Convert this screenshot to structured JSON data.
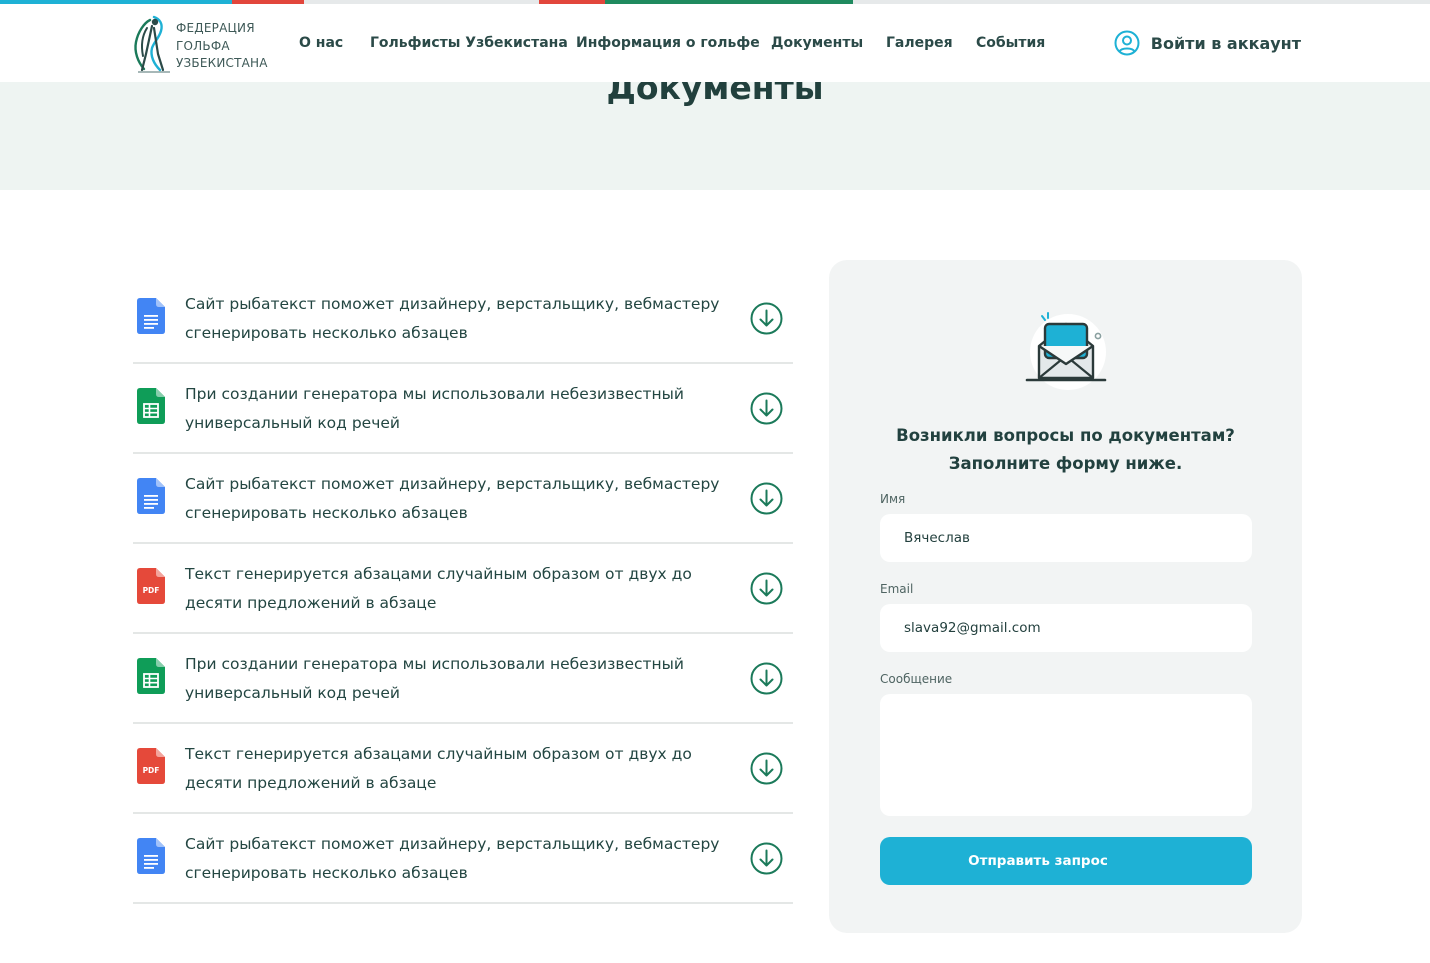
{
  "colors": {
    "accent": "#1eb1d5",
    "brand_green": "#1b7a5a",
    "text_dark": "#21403d",
    "hero_bg": "#eef4f2",
    "card_bg": "#f2f4f4",
    "topbar_red": "#e2463c",
    "topbar_green": "#1f8a5f",
    "topbar_blue": "#1eb1d5"
  },
  "header": {
    "logo": {
      "icon": "golf-player-logo",
      "lines": [
        "ФЕДЕРАЦИЯ",
        "ГОЛЬФА",
        "УЗБЕКИСТАНА"
      ]
    },
    "nav": [
      {
        "label": "О нас"
      },
      {
        "label": "Гольфисты Узбекистана"
      },
      {
        "label": "Информация о гольфе"
      },
      {
        "label": "Документы"
      },
      {
        "label": "Галерея"
      },
      {
        "label": "События"
      }
    ],
    "login": {
      "icon": "user-circle-icon",
      "label": "Войти в аккаунт"
    }
  },
  "hero": {
    "title": "Документы"
  },
  "documents": [
    {
      "type": "doc",
      "icon": "google-docs-icon",
      "text": "Сайт рыбатекст поможет дизайнеру, верстальщику, вебмастеру сгенерировать несколько абзацев"
    },
    {
      "type": "sheet",
      "icon": "google-sheets-icon",
      "text": "При создании генератора мы использовали небезизвестный универсальный код речей"
    },
    {
      "type": "doc",
      "icon": "google-docs-icon",
      "text": "Сайт рыбатекст поможет дизайнеру, верстальщику, вебмастеру сгенерировать несколько абзацев"
    },
    {
      "type": "pdf",
      "icon": "pdf-file-icon",
      "text": "Текст генерируется абзацами случайным образом от двух до десяти предложений в абзаце"
    },
    {
      "type": "sheet",
      "icon": "google-sheets-icon",
      "text": "При создании генератора мы использовали небезизвестный универсальный код речей"
    },
    {
      "type": "pdf",
      "icon": "pdf-file-icon",
      "text": "Текст генерируется абзацами случайным образом от двух до десяти предложений в абзаце"
    },
    {
      "type": "doc",
      "icon": "google-docs-icon",
      "text": "Сайт рыбатекст поможет дизайнеру, верстальщику, вебмастеру сгенерировать несколько абзацев"
    }
  ],
  "pdf_badge": "PDF",
  "download_icon": "download-arrow-icon",
  "form": {
    "illustration": "open-envelope-icon",
    "heading_line1": "Возникли вопросы по документам?",
    "heading_line2": "Заполните форму ниже.",
    "name_label": "Имя",
    "name_value": "Вячеслав",
    "email_label": "Email",
    "email_value": "slava92@gmail.com",
    "message_label": "Сообщение",
    "message_value": "",
    "submit_label": "Отправить запрос"
  }
}
